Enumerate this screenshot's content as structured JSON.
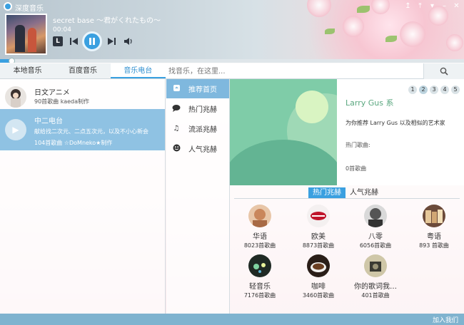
{
  "app": {
    "title": "深度音乐"
  },
  "window_buttons": [
    "↥",
    "⤒",
    "▾",
    "–",
    "✕"
  ],
  "player": {
    "song": "secret base ～君がくれたもの～",
    "time": "00:04",
    "lyric_label": "L",
    "progress": 0.025
  },
  "tabs": [
    {
      "label": "本地音乐",
      "active": false
    },
    {
      "label": "百度音乐",
      "active": false
    },
    {
      "label": "音乐电台",
      "active": true
    }
  ],
  "search": {
    "placeholder": "找音乐，在这里..."
  },
  "radios": [
    {
      "name": "日文アニメ",
      "desc": "90首歌曲 kaeda制作"
    },
    {
      "name": "中二电台",
      "desc": "献给找二次元、二点五次元，以及不小心新会",
      "sub": "104首歌曲 ☆DoMneko★制作"
    }
  ],
  "nav": [
    {
      "label": "推荐首页",
      "icon": "home-icon",
      "active": true
    },
    {
      "label": "热门兆赫",
      "icon": "chat-icon",
      "active": false
    },
    {
      "label": "流派兆赫",
      "icon": "music-note-icon",
      "active": false
    },
    {
      "label": "人气兆赫",
      "icon": "smiley-icon",
      "active": false
    }
  ],
  "recommend": {
    "pages": [
      "1",
      "2",
      "3",
      "4",
      "5"
    ],
    "active_page": 2,
    "artist": "Larry Gus 系",
    "text": "为你推荐 Larry Gus 以及相似的艺术家",
    "hot_label": "热门歌曲:",
    "count_label": "0首歌曲"
  },
  "subtabs": [
    {
      "label": "热门兆赫",
      "active": true
    },
    {
      "label": "人气兆赫",
      "active": false
    }
  ],
  "categories": [
    {
      "name": "华语",
      "count": "8023首歌曲"
    },
    {
      "name": "欧美",
      "count": "8873首歌曲"
    },
    {
      "name": "八零",
      "count": "6056首歌曲"
    },
    {
      "name": "粤语",
      "count": "893 首歌曲"
    },
    {
      "name": "轻音乐",
      "count": "7176首歌曲"
    },
    {
      "name": "咖啡",
      "count": "3460首歌曲"
    },
    {
      "name": "你的歌词我…",
      "count": "401首歌曲"
    }
  ],
  "status": {
    "text": "加入我们"
  },
  "colors": {
    "accent": "#3aa0e0",
    "selected": "#8fc2e3",
    "artist": "#5aa77f",
    "status": "#7fb3cf"
  }
}
